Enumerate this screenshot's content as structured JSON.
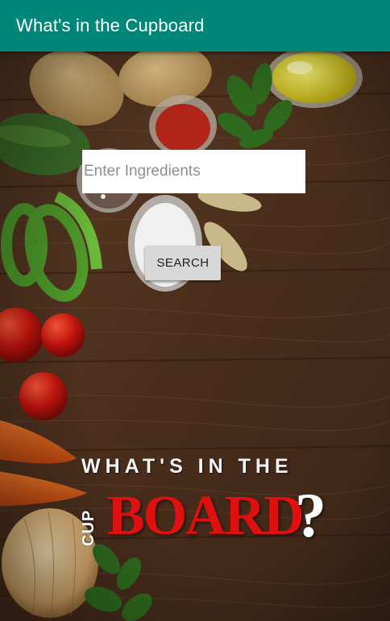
{
  "app_bar": {
    "title": "What's in the Cupboard"
  },
  "search": {
    "placeholder": "Enter Ingredients",
    "value": "",
    "button_label": "SEARCH"
  },
  "logo": {
    "line1": "WHAT'S IN THE",
    "cup": "CUP",
    "board": "BOARD",
    "mark": "?"
  },
  "colors": {
    "app_bar": "#00877a",
    "button": "#d8d8d8",
    "logo_red": "#e01010",
    "wood": "#4a2e1c"
  },
  "background_icons": [
    "potato-icon",
    "zucchini-icon",
    "spice-jar-icon",
    "olive-oil-icon",
    "green-pepper-icon",
    "tomato-icon",
    "carrot-icon",
    "onion-icon",
    "basil-icon"
  ]
}
